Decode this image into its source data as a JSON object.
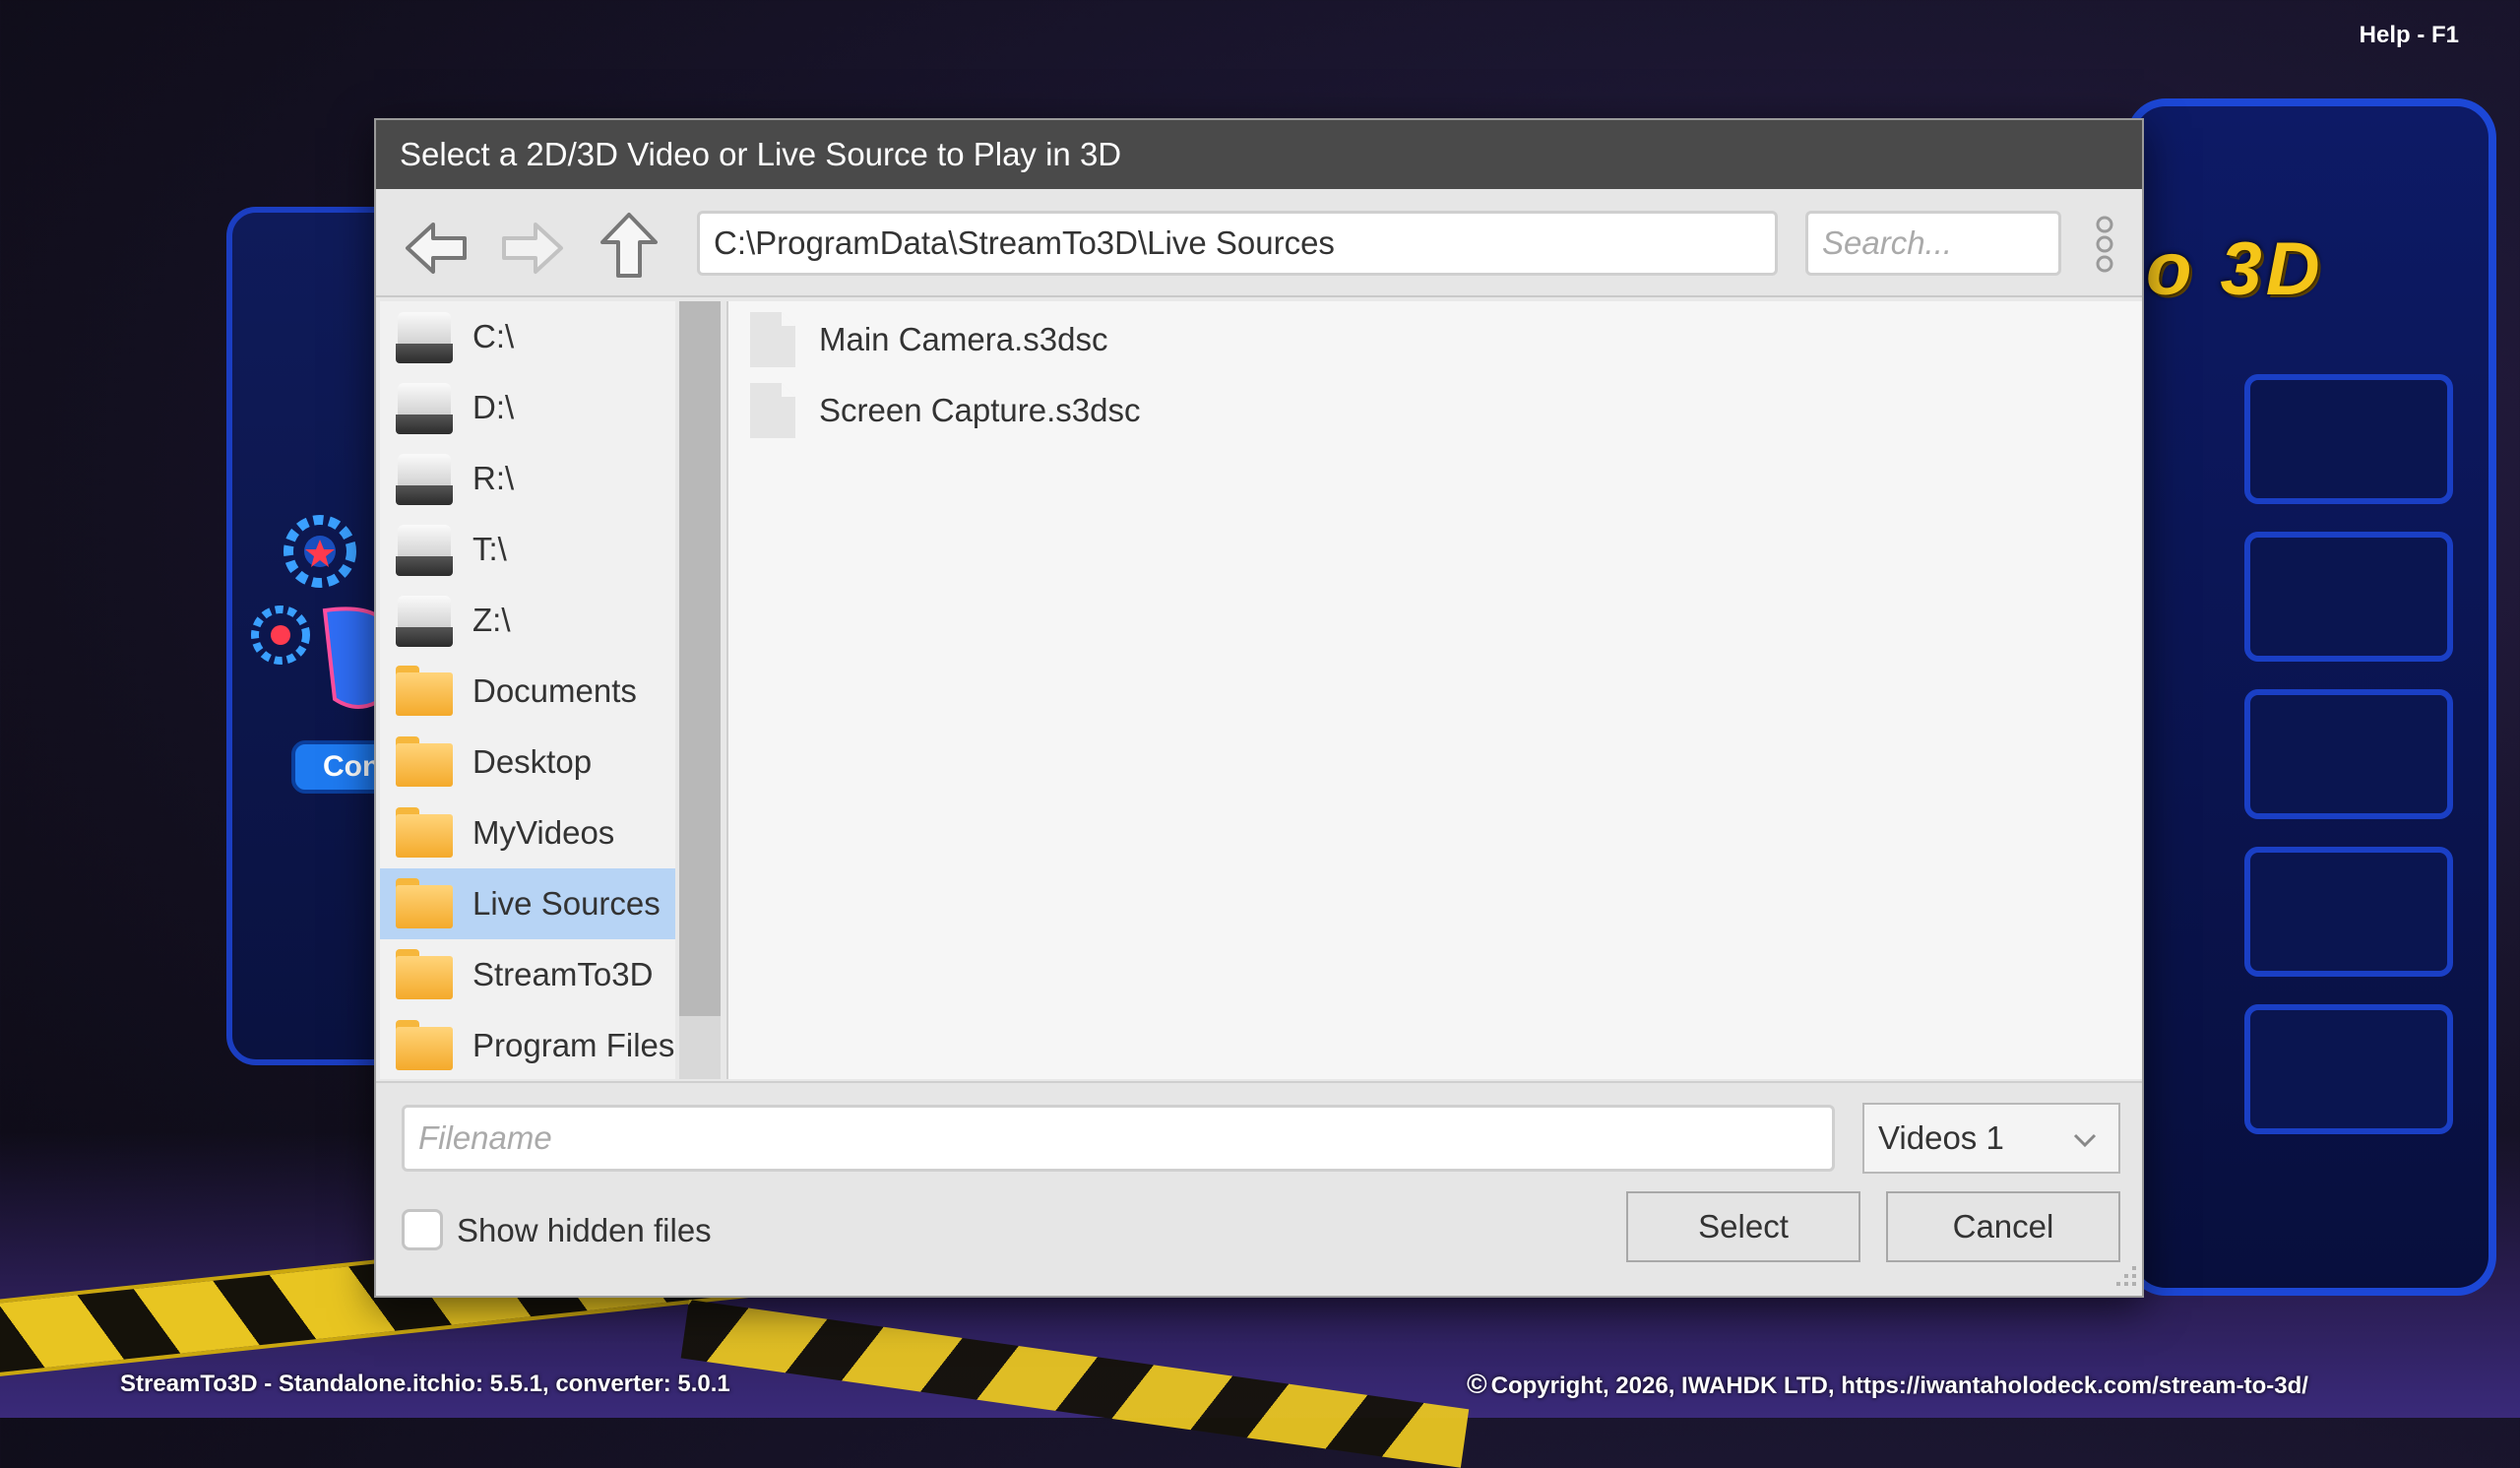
{
  "app": {
    "help_label": "Help - F1",
    "brand_fragment": "o 3D",
    "config_button_label": "Conf",
    "footer_version": "StreamTo3D - Standalone.itchio: 5.5.1, converter: 5.0.1",
    "footer_copyright": "Copyright, 2026, IWAHDK LTD, https://iwantaholodeck.com/stream-to-3d/",
    "colors": {
      "accent_blue": "#1e7af0",
      "brand_yellow": "#f5c518",
      "selection": "#b7d4f5",
      "titlebar": "#4a4a4a"
    }
  },
  "dialog": {
    "title": "Select a 2D/3D Video or Live Source to Play in 3D",
    "toolbar": {
      "back_icon": "arrow-left-icon",
      "forward_icon": "arrow-right-icon",
      "up_icon": "arrow-up-icon",
      "path": "C:\\ProgramData\\StreamTo3D\\Live Sources",
      "search_placeholder": "Search...",
      "more_icon": "more-vertical-icon"
    },
    "sidebar": {
      "items": [
        {
          "label": "C:\\",
          "icon": "drive-icon",
          "selected": false
        },
        {
          "label": "D:\\",
          "icon": "drive-icon",
          "selected": false
        },
        {
          "label": "R:\\",
          "icon": "drive-icon",
          "selected": false
        },
        {
          "label": "T:\\",
          "icon": "drive-icon",
          "selected": false
        },
        {
          "label": "Z:\\",
          "icon": "drive-icon",
          "selected": false
        },
        {
          "label": "Documents",
          "icon": "folder-icon",
          "selected": false
        },
        {
          "label": "Desktop",
          "icon": "folder-icon",
          "selected": false
        },
        {
          "label": "MyVideos",
          "icon": "folder-icon",
          "selected": false
        },
        {
          "label": "Live Sources",
          "icon": "folder-icon",
          "selected": true
        },
        {
          "label": "StreamTo3D",
          "icon": "folder-icon",
          "selected": false
        },
        {
          "label": "Program Files",
          "icon": "folder-icon",
          "selected": false
        }
      ]
    },
    "files": [
      {
        "name": "Main Camera.s3dsc",
        "icon": "file-icon"
      },
      {
        "name": "Screen Capture.s3dsc",
        "icon": "file-icon"
      }
    ],
    "bottom": {
      "filename_placeholder": "Filename",
      "filename_value": "",
      "filter_selected": "Videos 1",
      "show_hidden_label": "Show hidden files",
      "show_hidden_checked": false,
      "select_label": "Select",
      "cancel_label": "Cancel"
    }
  }
}
